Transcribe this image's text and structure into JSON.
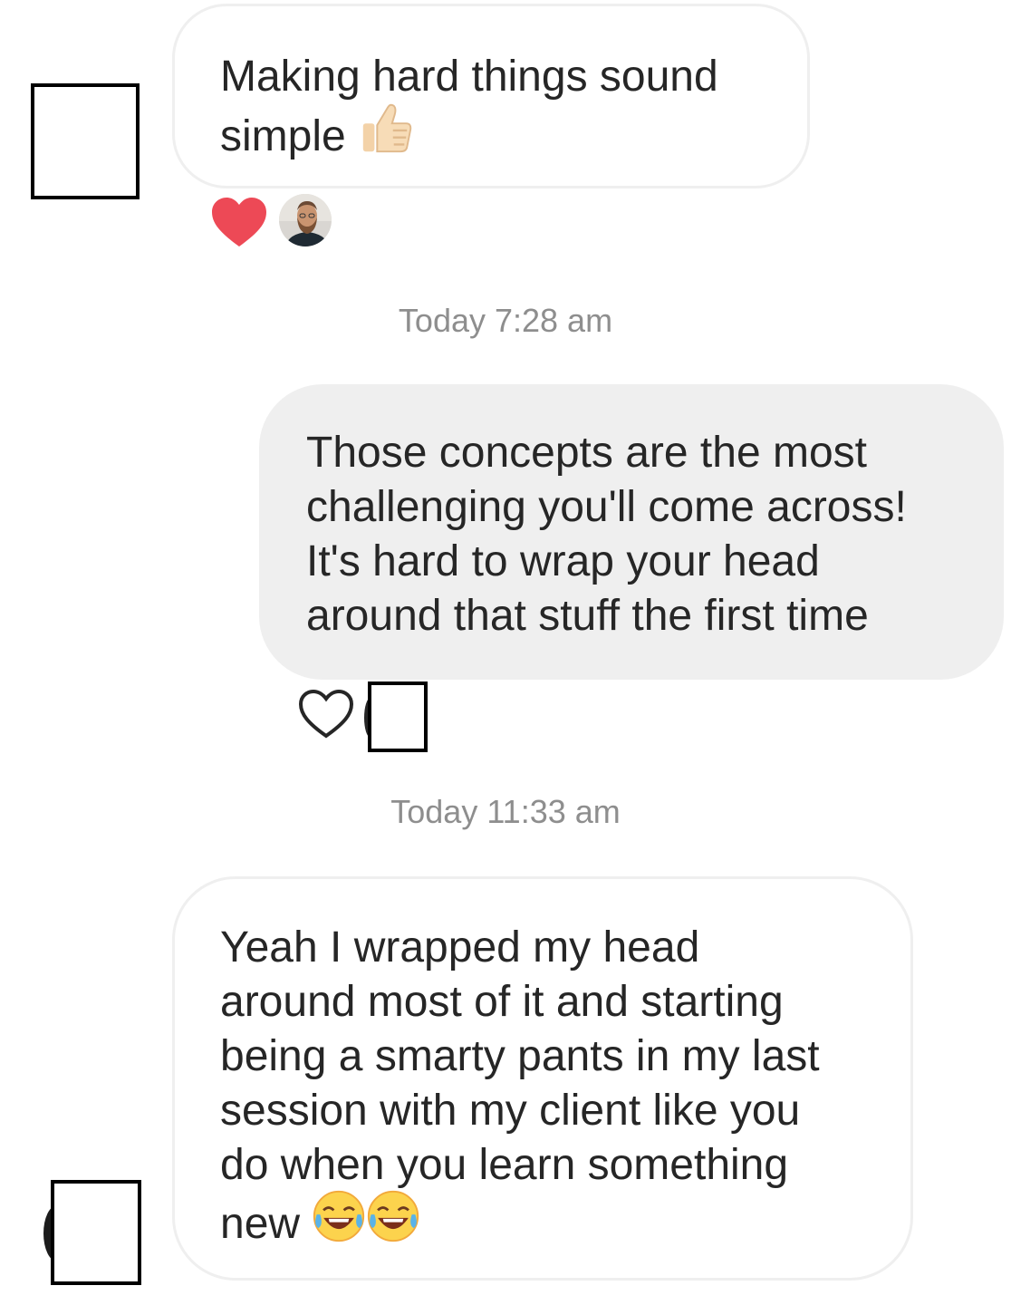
{
  "colors": {
    "incoming_bubble_bg": "#ffffff",
    "incoming_bubble_border": "#efefef",
    "outgoing_bubble_bg": "#efefef",
    "timestamp_text": "#8e8e8e",
    "reaction_heart": "#ed4956"
  },
  "thread": {
    "msg1": {
      "sender": "incoming",
      "lines": [
        "Making hard things sound",
        "simple"
      ],
      "emoji": "thumbs-up-light-skin-icon",
      "reactions": {
        "icon": "filled-heart-icon",
        "reactor": "reactor-avatar"
      }
    },
    "timestamp1": "Today 7:28 am",
    "msg2": {
      "sender": "outgoing",
      "lines": [
        "Those concepts are the most",
        "challenging you'll come across!",
        "It's hard to wrap your head",
        "around that stuff the first time"
      ],
      "reactions": {
        "icon": "outline-heart-icon"
      }
    },
    "timestamp2": "Today 11:33 am",
    "msg3": {
      "sender": "incoming",
      "lines": [
        "Yeah I wrapped my head",
        "around most of it and starting",
        "being a smarty pants in my last",
        "session with my client like you",
        "do when you learn something",
        "new"
      ],
      "emoji": [
        "tears-of-joy-icon",
        "tears-of-joy-icon"
      ]
    }
  }
}
